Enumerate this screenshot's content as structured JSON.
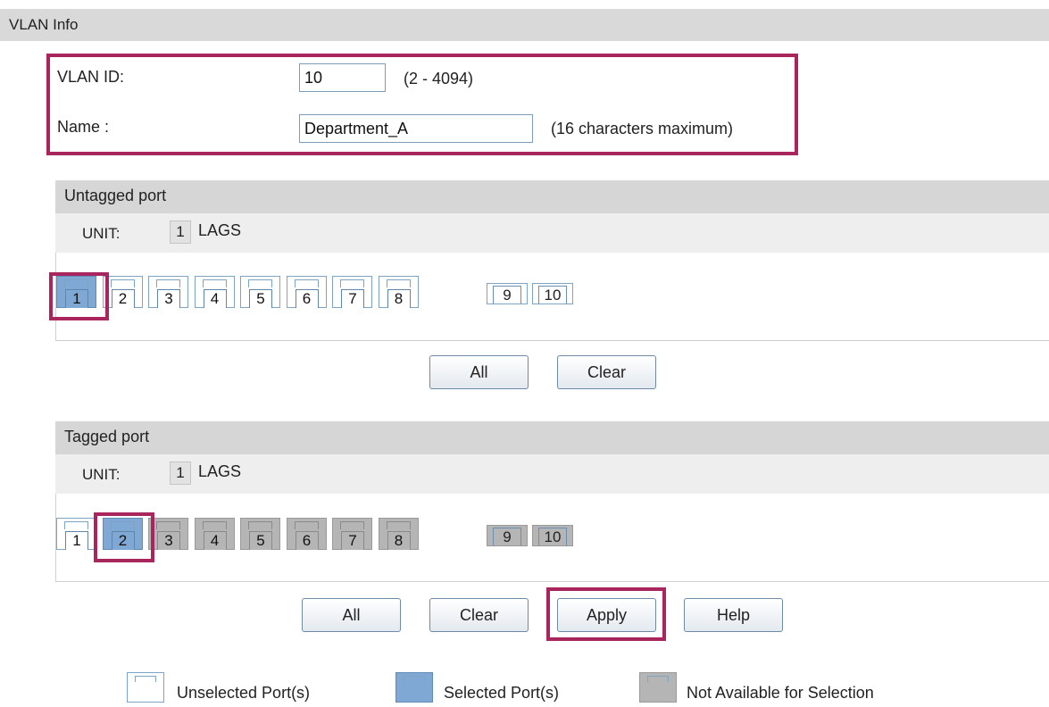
{
  "section": {
    "title": "VLAN Info"
  },
  "vlan": {
    "id_label": "VLAN ID:",
    "id_value": "10",
    "id_hint": "(2 - 4094)",
    "name_label": "Name :",
    "name_value": "Department_A",
    "name_hint": "(16 characters maximum)"
  },
  "untagged": {
    "title": "Untagged port",
    "unit_label": "UNIT:",
    "unit_value": "1",
    "lags_label": "LAGS",
    "ports": [
      {
        "label": "1",
        "state": "selected"
      },
      {
        "label": "2",
        "state": "unselected"
      },
      {
        "label": "3",
        "state": "unselected"
      },
      {
        "label": "4",
        "state": "unselected"
      },
      {
        "label": "5",
        "state": "unselected"
      },
      {
        "label": "6",
        "state": "unselected"
      },
      {
        "label": "7",
        "state": "unselected"
      },
      {
        "label": "8",
        "state": "unselected"
      }
    ],
    "sfp": [
      {
        "label": "9",
        "state": "unselected"
      },
      {
        "label": "10",
        "state": "unselected"
      }
    ],
    "all_label": "All",
    "clear_label": "Clear"
  },
  "tagged": {
    "title": "Tagged port",
    "unit_label": "UNIT:",
    "unit_value": "1",
    "lags_label": "LAGS",
    "ports": [
      {
        "label": "1",
        "state": "unselected"
      },
      {
        "label": "2",
        "state": "selected"
      },
      {
        "label": "3",
        "state": "unavailable"
      },
      {
        "label": "4",
        "state": "unavailable"
      },
      {
        "label": "5",
        "state": "unavailable"
      },
      {
        "label": "6",
        "state": "unavailable"
      },
      {
        "label": "7",
        "state": "unavailable"
      },
      {
        "label": "8",
        "state": "unavailable"
      }
    ],
    "sfp": [
      {
        "label": "9",
        "state": "unavailable"
      },
      {
        "label": "10",
        "state": "unavailable"
      }
    ],
    "all_label": "All",
    "clear_label": "Clear"
  },
  "actions": {
    "apply_label": "Apply",
    "help_label": "Help"
  },
  "legend": {
    "unselected": "Unselected Port(s)",
    "selected": "Selected Port(s)",
    "unavailable": "Not Available for Selection"
  },
  "colors": {
    "highlight": "#a8255d",
    "selected_port": "#7fa8d4",
    "unavailable_port": "#b5b5b5",
    "header_bg": "#d9d9d9"
  }
}
